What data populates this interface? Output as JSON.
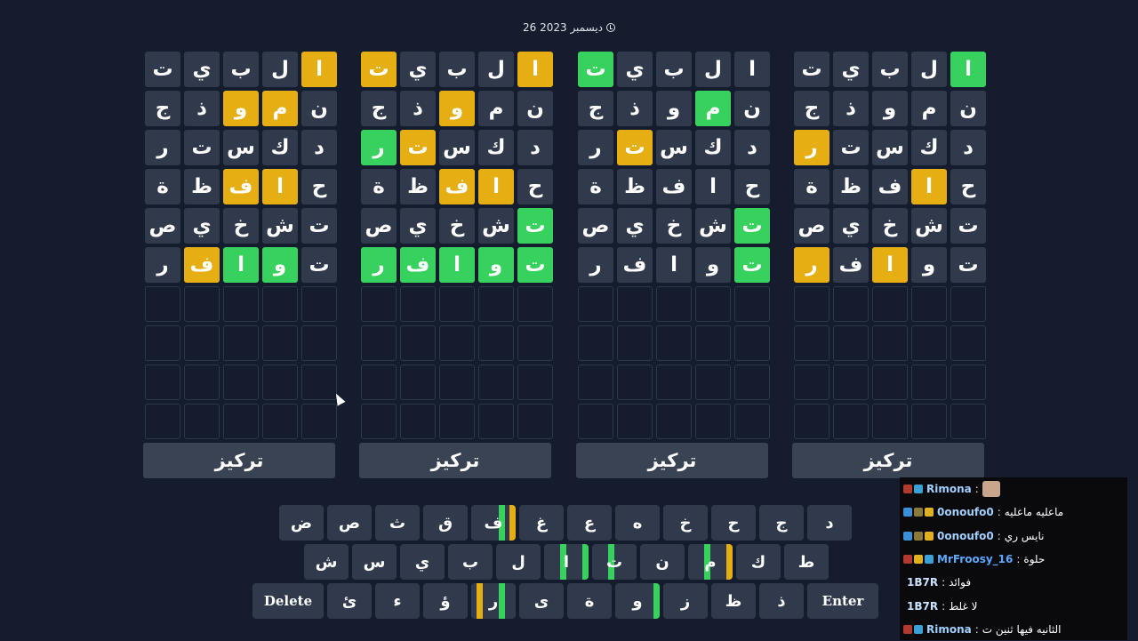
{
  "header": {
    "date": "26 ديسمبر 2023"
  },
  "boards": [
    {
      "rows": [
        [
          [
            "ا",
            "y"
          ],
          [
            "ل",
            "a"
          ],
          [
            "ب",
            "a"
          ],
          [
            "ي",
            "a"
          ],
          [
            "ت",
            "a"
          ]
        ],
        [
          [
            "ن",
            "a"
          ],
          [
            "م",
            "y"
          ],
          [
            "و",
            "y"
          ],
          [
            "ذ",
            "a"
          ],
          [
            "ج",
            "a"
          ]
        ],
        [
          [
            "د",
            "a"
          ],
          [
            "ك",
            "a"
          ],
          [
            "س",
            "a"
          ],
          [
            "ت",
            "a"
          ],
          [
            "ر",
            "a"
          ]
        ],
        [
          [
            "ح",
            "a"
          ],
          [
            "ا",
            "y"
          ],
          [
            "ف",
            "y"
          ],
          [
            "ظ",
            "a"
          ],
          [
            "ة",
            "a"
          ]
        ],
        [
          [
            "ت",
            "a"
          ],
          [
            "ش",
            "a"
          ],
          [
            "خ",
            "a"
          ],
          [
            "ي",
            "a"
          ],
          [
            "ص",
            "a"
          ]
        ],
        [
          [
            "ت",
            "a"
          ],
          [
            "و",
            "g"
          ],
          [
            "ا",
            "g"
          ],
          [
            "ف",
            "y"
          ],
          [
            "ر",
            "a"
          ]
        ]
      ],
      "button": "تركيز"
    },
    {
      "rows": [
        [
          [
            "ا",
            "y"
          ],
          [
            "ل",
            "a"
          ],
          [
            "ب",
            "a"
          ],
          [
            "ي",
            "a"
          ],
          [
            "ت",
            "y"
          ]
        ],
        [
          [
            "ن",
            "a"
          ],
          [
            "م",
            "a"
          ],
          [
            "و",
            "y"
          ],
          [
            "ذ",
            "a"
          ],
          [
            "ج",
            "a"
          ]
        ],
        [
          [
            "د",
            "a"
          ],
          [
            "ك",
            "a"
          ],
          [
            "س",
            "a"
          ],
          [
            "ت",
            "y"
          ],
          [
            "ر",
            "g"
          ]
        ],
        [
          [
            "ح",
            "a"
          ],
          [
            "ا",
            "y"
          ],
          [
            "ف",
            "y"
          ],
          [
            "ظ",
            "a"
          ],
          [
            "ة",
            "a"
          ]
        ],
        [
          [
            "ت",
            "g"
          ],
          [
            "ش",
            "a"
          ],
          [
            "خ",
            "a"
          ],
          [
            "ي",
            "a"
          ],
          [
            "ص",
            "a"
          ]
        ],
        [
          [
            "ت",
            "g"
          ],
          [
            "و",
            "g"
          ],
          [
            "ا",
            "g"
          ],
          [
            "ف",
            "g"
          ],
          [
            "ر",
            "g"
          ]
        ]
      ],
      "button": "تركيز"
    },
    {
      "rows": [
        [
          [
            "ا",
            "a"
          ],
          [
            "ل",
            "a"
          ],
          [
            "ب",
            "a"
          ],
          [
            "ي",
            "a"
          ],
          [
            "ت",
            "g"
          ]
        ],
        [
          [
            "ن",
            "a"
          ],
          [
            "م",
            "g"
          ],
          [
            "و",
            "a"
          ],
          [
            "ذ",
            "a"
          ],
          [
            "ج",
            "a"
          ]
        ],
        [
          [
            "د",
            "a"
          ],
          [
            "ك",
            "a"
          ],
          [
            "س",
            "a"
          ],
          [
            "ت",
            "y"
          ],
          [
            "ر",
            "a"
          ]
        ],
        [
          [
            "ح",
            "a"
          ],
          [
            "ا",
            "a"
          ],
          [
            "ف",
            "a"
          ],
          [
            "ظ",
            "a"
          ],
          [
            "ة",
            "a"
          ]
        ],
        [
          [
            "ت",
            "g"
          ],
          [
            "ش",
            "a"
          ],
          [
            "خ",
            "a"
          ],
          [
            "ي",
            "a"
          ],
          [
            "ص",
            "a"
          ]
        ],
        [
          [
            "ت",
            "g"
          ],
          [
            "و",
            "a"
          ],
          [
            "ا",
            "a"
          ],
          [
            "ف",
            "a"
          ],
          [
            "ر",
            "a"
          ]
        ]
      ],
      "button": "تركيز"
    },
    {
      "rows": [
        [
          [
            "ا",
            "g"
          ],
          [
            "ل",
            "a"
          ],
          [
            "ب",
            "a"
          ],
          [
            "ي",
            "a"
          ],
          [
            "ت",
            "a"
          ]
        ],
        [
          [
            "ن",
            "a"
          ],
          [
            "م",
            "a"
          ],
          [
            "و",
            "a"
          ],
          [
            "ذ",
            "a"
          ],
          [
            "ج",
            "a"
          ]
        ],
        [
          [
            "د",
            "a"
          ],
          [
            "ك",
            "a"
          ],
          [
            "س",
            "a"
          ],
          [
            "ت",
            "a"
          ],
          [
            "ر",
            "y"
          ]
        ],
        [
          [
            "ح",
            "a"
          ],
          [
            "ا",
            "y"
          ],
          [
            "ف",
            "a"
          ],
          [
            "ظ",
            "a"
          ],
          [
            "ة",
            "a"
          ]
        ],
        [
          [
            "ت",
            "a"
          ],
          [
            "ش",
            "a"
          ],
          [
            "خ",
            "a"
          ],
          [
            "ي",
            "a"
          ],
          [
            "ص",
            "a"
          ]
        ],
        [
          [
            "ت",
            "a"
          ],
          [
            "و",
            "a"
          ],
          [
            "ا",
            "y"
          ],
          [
            "ف",
            "a"
          ],
          [
            "ر",
            "y"
          ]
        ]
      ],
      "button": "تركيز"
    }
  ],
  "colors": {
    "background": "#141c2d",
    "absent": "#303a4c",
    "present": "#e5ae13",
    "correct": "#37d25d",
    "chat_bg": "#0a0a0c",
    "user_link": "#9fd0ff"
  },
  "keyboard": {
    "rows": [
      [
        {
          "label": "د",
          "marks": []
        },
        {
          "label": "ج",
          "marks": []
        },
        {
          "label": "ح",
          "marks": []
        },
        {
          "label": "خ",
          "marks": []
        },
        {
          "label": "ه",
          "marks": []
        },
        {
          "label": "ع",
          "marks": []
        },
        {
          "label": "غ",
          "marks": []
        },
        {
          "label": "ف",
          "marks": [
            "y",
            "g",
            "a",
            "a"
          ]
        },
        {
          "label": "ق",
          "marks": []
        },
        {
          "label": "ث",
          "marks": []
        },
        {
          "label": "ص",
          "marks": []
        },
        {
          "label": "ض",
          "marks": []
        }
      ],
      [
        {
          "label": "ط",
          "marks": []
        },
        {
          "label": "ك",
          "marks": []
        },
        {
          "label": "م",
          "marks": [
            "y",
            "a",
            "g",
            "a"
          ]
        },
        {
          "label": "ن",
          "marks": []
        },
        {
          "label": "ت",
          "marks": [
            "a",
            "a",
            "g",
            "a"
          ]
        },
        {
          "label": "ا",
          "marks": [
            "g",
            "a",
            "g",
            "a"
          ]
        },
        {
          "label": "ل",
          "marks": []
        },
        {
          "label": "ب",
          "marks": []
        },
        {
          "label": "ي",
          "marks": []
        },
        {
          "label": "س",
          "marks": []
        },
        {
          "label": "ش",
          "marks": []
        }
      ],
      [
        {
          "label": "Enter",
          "wide": true,
          "marks": []
        },
        {
          "label": "ذ",
          "marks": []
        },
        {
          "label": "ظ",
          "marks": []
        },
        {
          "label": "ز",
          "marks": []
        },
        {
          "label": "و",
          "marks": [
            "g",
            "a",
            "a",
            "a"
          ]
        },
        {
          "label": "ة",
          "marks": []
        },
        {
          "label": "ى",
          "marks": []
        },
        {
          "label": "ر",
          "marks": [
            "a",
            "g",
            "a",
            "y"
          ]
        },
        {
          "label": "ؤ",
          "marks": []
        },
        {
          "label": "ء",
          "marks": []
        },
        {
          "label": "ئ",
          "marks": []
        },
        {
          "label": "Delete",
          "wide": true,
          "marks": []
        }
      ]
    ]
  },
  "chat": {
    "messages": [
      {
        "user": "Rimona",
        "text": "",
        "badges": [
          "#b13a2e",
          "#3aa0d6"
        ],
        "avatar": true
      },
      {
        "user": "0onoufo0",
        "text": "ماعليه ماعليه",
        "badges": [
          "#3a8fd6",
          "#8a7a3a",
          "#e0b020"
        ]
      },
      {
        "user": "0onoufo0",
        "text": "نايس ري",
        "badges": [
          "#3a8fd6",
          "#8a7a3a",
          "#e0b020"
        ]
      },
      {
        "user": "MrFroosy_16",
        "text": "حلوة",
        "badges": [
          "#b13a2e",
          "#e0b020",
          "#3aa0d6"
        ]
      },
      {
        "user": "1B7R",
        "text": "فوائد",
        "badges": []
      },
      {
        "user": "1B7R",
        "text": "لا غلط",
        "badges": []
      },
      {
        "user": "Rimona",
        "text": "الثانيه فيها ثنين ت",
        "badges": [
          "#b13a2e",
          "#3aa0d6"
        ]
      }
    ]
  }
}
